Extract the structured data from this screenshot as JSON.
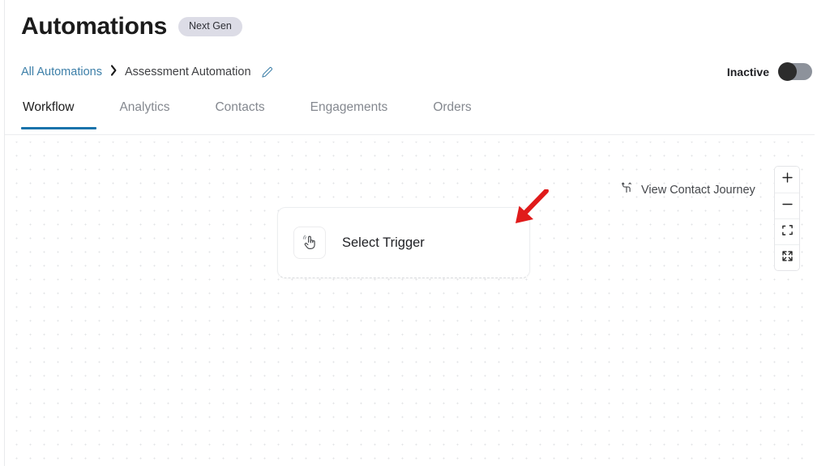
{
  "header": {
    "title": "Automations",
    "badge": "Next Gen"
  },
  "breadcrumb": {
    "parent": "All Automations",
    "separator": "›",
    "current": "Assessment Automation",
    "edit_icon": "pencil-edit-icon"
  },
  "status": {
    "label": "Inactive",
    "active": false,
    "track_color": "#8d929b",
    "knob_color": "#2c2c2c"
  },
  "tabs": {
    "active_index": 0,
    "accent_color": "#1a73ab",
    "items": [
      {
        "label": "Workflow"
      },
      {
        "label": "Analytics"
      },
      {
        "label": "Contacts"
      },
      {
        "label": "Engagements"
      },
      {
        "label": "Orders"
      }
    ]
  },
  "canvas": {
    "trigger_node": {
      "label": "Select Trigger",
      "icon": "tap-hand-icon"
    },
    "journey_button": {
      "label": "View Contact Journey",
      "icon": "contact-journey-branch-icon"
    },
    "annotation": {
      "type": "red-arrow",
      "color": "#e01b1b",
      "direction": "down-left"
    },
    "zoom_controls": [
      {
        "name": "zoom-in-button",
        "icon": "plus-icon"
      },
      {
        "name": "zoom-out-button",
        "icon": "minus-icon"
      },
      {
        "name": "fit-view-button",
        "icon": "fit-corners-icon"
      },
      {
        "name": "expand-view-button",
        "icon": "expand-arrows-icon"
      }
    ]
  }
}
